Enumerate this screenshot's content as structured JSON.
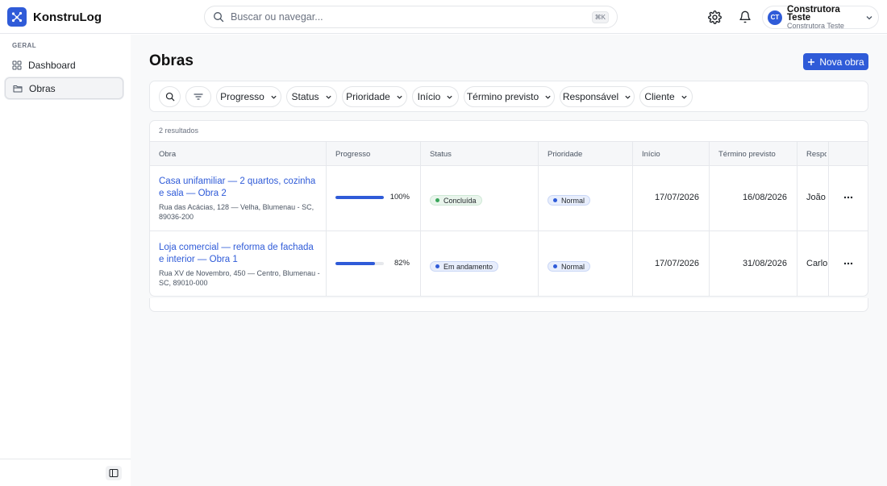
{
  "app": {
    "name": "KonstruLog"
  },
  "search": {
    "placeholder": "Buscar ou navegar...",
    "shortcut": "⌘K"
  },
  "user": {
    "initials": "CT",
    "name": "Construtora Teste",
    "org": "Construtora Teste"
  },
  "sidebar": {
    "section": "GERAL",
    "items": [
      {
        "label": "Dashboard",
        "icon": "grid-icon",
        "active": false
      },
      {
        "label": "Obras",
        "icon": "folder-icon",
        "active": true
      }
    ]
  },
  "page": {
    "title": "Obras",
    "new_button": "Nova obra",
    "filters": [
      "Progresso",
      "Status",
      "Prioridade",
      "Início",
      "Término previsto",
      "Responsável",
      "Cliente"
    ],
    "results_count": "2 resultados"
  },
  "table": {
    "columns": [
      "Obra",
      "Progresso",
      "Status",
      "Prioridade",
      "Início",
      "Término previsto",
      "Respo"
    ],
    "rows": [
      {
        "title": "Casa unifamiliar — 2 quartos, cozinha e sala — Obra 2",
        "address": "Rua das Acácias, 128 — Velha, Blumenau - SC, 89036-200",
        "progress": 100,
        "progress_label": "100%",
        "status": "Concluída",
        "priority": "Normal",
        "start": "17/07/2026",
        "end": "16/08/2026",
        "responsible": "João"
      },
      {
        "title": "Loja comercial — reforma de fachada e interior — Obra 1",
        "address": "Rua XV de Novembro, 450 — Centro, Blumenau - SC, 89010-000",
        "progress": 82,
        "progress_label": "82%",
        "status": "Em andamento",
        "priority": "Normal",
        "start": "17/07/2026",
        "end": "31/08/2026",
        "responsible": "Carlo"
      }
    ]
  },
  "colors": {
    "accent": "#2f5bd8",
    "status_done_bg": "#e9f5ec",
    "status_done_dot": "#3aa65a",
    "status_progress_bg": "#e8eefc",
    "status_progress_dot": "#2f5bd8",
    "priority_bg": "#e8eefc",
    "priority_dot": "#2f5bd8"
  }
}
